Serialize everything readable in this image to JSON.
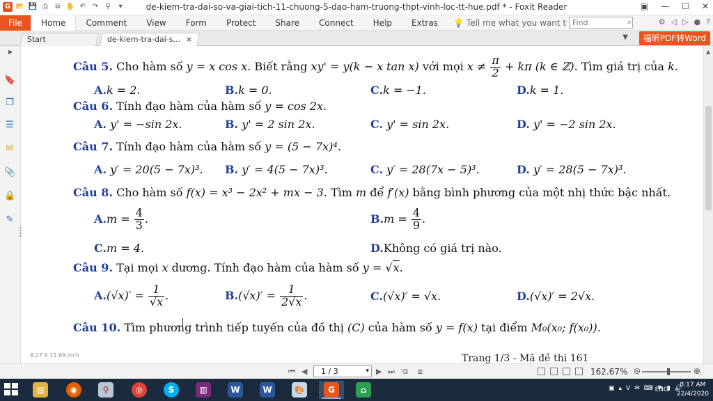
{
  "window": {
    "title": "de-kiem-tra-dai-so-va-giai-tich-11-chuong-5-dao-ham-truong-thpt-vinh-loc-tt-hue.pdf * - Foxit Reader"
  },
  "ribbon": {
    "file": "File",
    "menus": [
      "Home",
      "Comment",
      "View",
      "Form",
      "Protect",
      "Share",
      "Connect",
      "Help",
      "Extras"
    ],
    "tell_me": "Tell me what you want t",
    "find_placeholder": "Find"
  },
  "tabs": {
    "start": "Start",
    "doc": "de-kiem-tra-dai-s...",
    "close": "×",
    "promo": "福昕PDF转Word"
  },
  "document": {
    "q5": {
      "label": "Câu 5.",
      "text_a": "Cho hàm số",
      "expr1": "y = x cos x.",
      "text_b": "Biết rằng",
      "expr2": "xy' = y(k − x tan x)",
      "text_c": "với mọi",
      "expr3": "x ≠",
      "frac_num": "π",
      "frac_den": "2",
      "expr4": "+ kπ (k ∈ ℤ).",
      "text_d": "Tìm giá trị của",
      "expr5": "k.",
      "answers": [
        {
          "letter": "A.",
          "value": "k = 2."
        },
        {
          "letter": "B.",
          "value": "k = 0."
        },
        {
          "letter": "C.",
          "value": "k = −1."
        },
        {
          "letter": "D.",
          "value": "k = 1."
        }
      ]
    },
    "q6": {
      "label": "Câu 6.",
      "text": "Tính đạo hàm của hàm số",
      "expr": "y = cos 2x.",
      "answers": [
        {
          "letter": "A.",
          "value": "y' = −sin 2x."
        },
        {
          "letter": "B.",
          "value": "y' = 2 sin 2x."
        },
        {
          "letter": "C.",
          "value": "y' = sin 2x."
        },
        {
          "letter": "D.",
          "value": "y' = −2 sin 2x."
        }
      ]
    },
    "q7": {
      "label": "Câu 7.",
      "text": "Tính đạo hàm của hàm số",
      "expr": "y = (5 − 7x)⁴.",
      "answers": [
        {
          "letter": "A.",
          "value": "y′ = 20(5 − 7x)³."
        },
        {
          "letter": "B.",
          "value": "y′ = 4(5 − 7x)³."
        },
        {
          "letter": "C.",
          "value": "y′ = 28(7x − 5)³."
        },
        {
          "letter": "D.",
          "value": "y′ = 28(5 − 7x)³."
        }
      ]
    },
    "q8": {
      "label": "Câu 8.",
      "text_a": "Cho hàm số",
      "expr1": "f(x) = x³ − 2x² + mx − 3.",
      "text_b": "Tìm",
      "expr2": "m",
      "text_c": "để",
      "expr3": "f′(x)",
      "text_d": "bằng bình phương của một nhị thức bậc nhất.",
      "answers": [
        {
          "letter": "A.",
          "prefix": "m =",
          "num": "4",
          "den": "3",
          "suffix": "."
        },
        {
          "letter": "B.",
          "prefix": "m =",
          "num": "4",
          "den": "9",
          "suffix": "."
        },
        {
          "letter": "C.",
          "value": "m = 4."
        },
        {
          "letter": "D.",
          "value": "Không có giá trị nào."
        }
      ]
    },
    "q9": {
      "label": "Câu 9.",
      "text_a": "Tại mọi",
      "expr1": "x",
      "text_b": "dương. Tính đạo hàm của hàm số",
      "expr2": "y = ",
      "expr3": "x",
      "expr4": ".",
      "answers": [
        {
          "letter": "A.",
          "lhs": "(√x)′ =",
          "num": "1",
          "den": "√x",
          "suffix": "."
        },
        {
          "letter": "B.",
          "lhs": "(√x)′ =",
          "num": "1",
          "den": "2√x",
          "suffix": "."
        },
        {
          "letter": "C.",
          "value": "(√x)′ = √x."
        },
        {
          "letter": "D.",
          "value": "(√x)′ = 2√x."
        }
      ]
    },
    "q10": {
      "label": "Câu 10.",
      "text_a": "Tìm phương trình tiếp tuyến của đồ thị",
      "expr1": "(C)",
      "text_b": "của hàm số",
      "expr2": "y = f(x)",
      "text_c": "tại điểm",
      "expr3": "M₀(x₀; f(x₀))."
    },
    "page_footer": "Trang 1/3 - Mã đề thi 161",
    "page_size": "8.27 X 11.69 inch"
  },
  "statusbar": {
    "page_value": "1 / 3",
    "zoom": "162.67%"
  },
  "taskbar": {
    "lang": "ENG",
    "time": "8:17 AM",
    "date": "22/4/2020"
  },
  "colors": {
    "accent": "#e8551e",
    "question_label": "#1f3f97",
    "taskbar": "#1b2a3c"
  }
}
